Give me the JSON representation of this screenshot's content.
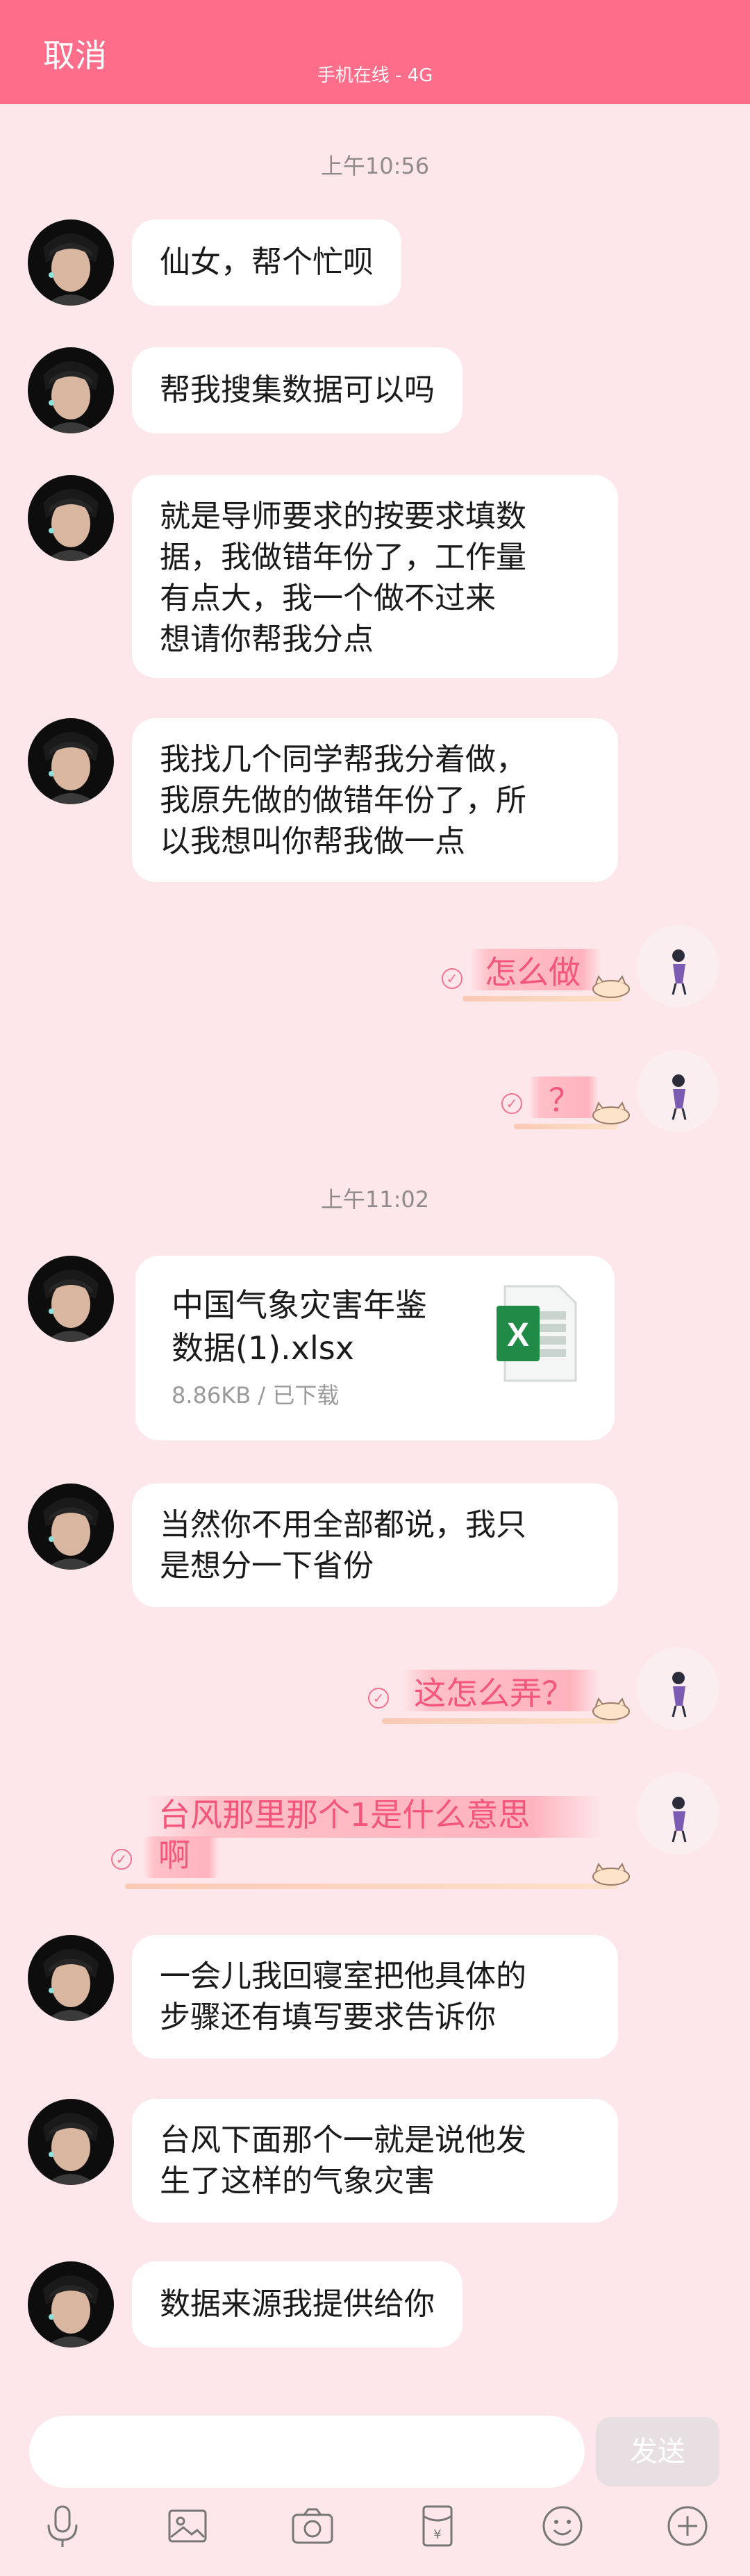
{
  "header": {
    "cancel_label": "取消",
    "status": "手机在线 - 4G"
  },
  "timestamps": [
    "上午10:56",
    "上午11:02"
  ],
  "messages": [
    {
      "side": "other",
      "text": "仙女，帮个忙呗"
    },
    {
      "side": "other",
      "text": "帮我搜集数据可以吗"
    },
    {
      "side": "other",
      "text": "就是导师要求的按要求填数\n据，我做错年份了，工作量\n有点大，我一个做不过来\n想请你帮我分点"
    },
    {
      "side": "other",
      "text": "我找几个同学帮我分着做，\n我原先做的做错年份了，所\n以我想叫你帮我做一点"
    },
    {
      "side": "self",
      "text": "怎么做"
    },
    {
      "side": "self",
      "text": "？"
    },
    {
      "side": "other",
      "type": "file",
      "file_name": "中国气象灾害年鉴\n数据(1).xlsx",
      "file_meta": "8.86KB / 已下载",
      "file_icon": "excel-icon"
    },
    {
      "side": "other",
      "text": "当然你不用全部都说，我只\n是想分一下省份"
    },
    {
      "side": "self",
      "text": "这怎么弄？"
    },
    {
      "side": "self",
      "text": "台风那里那个1是什么意思\n啊"
    },
    {
      "side": "other",
      "text": "一会儿我回寝室把他具体的\n步骤还有填写要求告诉你"
    },
    {
      "side": "other",
      "text": "台风下面那个一就是说他发\n生了这样的气象灾害"
    },
    {
      "side": "other",
      "text": "数据来源我提供给你"
    }
  ],
  "input": {
    "placeholder": "",
    "send_label": "发送"
  },
  "toolbar": [
    "microphone-icon",
    "image-icon",
    "camera-icon",
    "red-packet-icon",
    "emoji-icon",
    "plus-icon"
  ],
  "colors": {
    "header": "#fe6d8a",
    "background": "#fde7ea",
    "self_text": "#f3567a",
    "excel_green": "#1f8b46"
  }
}
